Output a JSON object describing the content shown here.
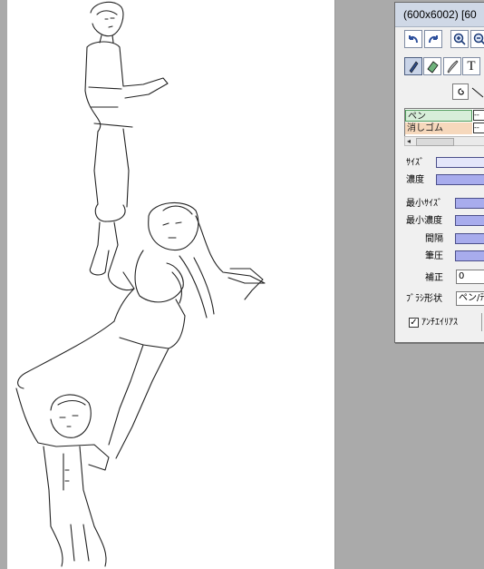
{
  "window": {
    "title": "(600x6002) [60"
  },
  "toolbar": {
    "undo_icon": "undo-icon",
    "redo_icon": "redo-icon",
    "zoom_in_icon": "zoom-in-icon",
    "zoom_out_icon": "zoom-out-icon",
    "text_tool_label": "T"
  },
  "tool_list": {
    "items": [
      {
        "label": "ペン",
        "color": "#d7eed9"
      },
      {
        "label": "消しゴム",
        "color": "#f6d8bc"
      }
    ]
  },
  "params": {
    "size_label": "ｻｲｽﾞ",
    "density_label": "濃度",
    "min_size_label": "最小ｻｲｽﾞ",
    "min_density_label": "最小濃度",
    "interval_label": "間隔",
    "pressure_label": "筆圧",
    "correction_label": "補正",
    "correction_value": "0",
    "brush_shape_label": "ﾌﾞﾗｼ形状",
    "brush_shape_value": "ペン/ﾃ",
    "antialias_label": "ｱﾝﾁｴｲﾘｱｽ",
    "antialias_checked": "✓"
  },
  "colors": {
    "bar_fill": "#a8aced",
    "title_bar": "#cfd8e6",
    "canvas_bg": "#aaaaaa"
  }
}
